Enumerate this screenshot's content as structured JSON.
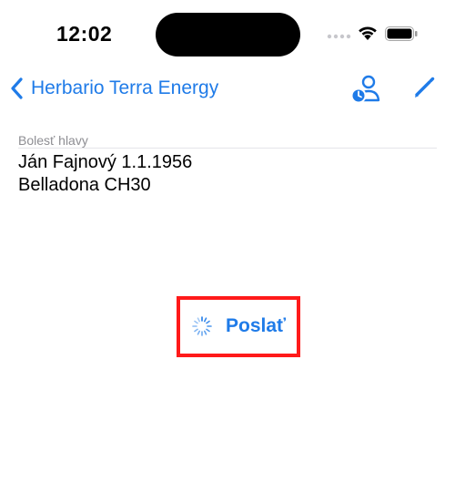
{
  "status": {
    "time": "12:02"
  },
  "nav": {
    "back_label": "Herbario Terra Energy"
  },
  "note": {
    "label": "Bolesť hlavy",
    "lines": [
      "Ján Fajnový  1.1.1956",
      "Belladona CH30"
    ]
  },
  "send": {
    "label": "Poslať"
  },
  "colors": {
    "accent": "#1f7be8",
    "highlight": "#ff1a1a",
    "label": "#8e8e93"
  },
  "icons": {
    "back": "chevron-left-icon",
    "contact": "person-clock-icon",
    "edit": "pencil-icon",
    "activity": "spinner-icon"
  }
}
